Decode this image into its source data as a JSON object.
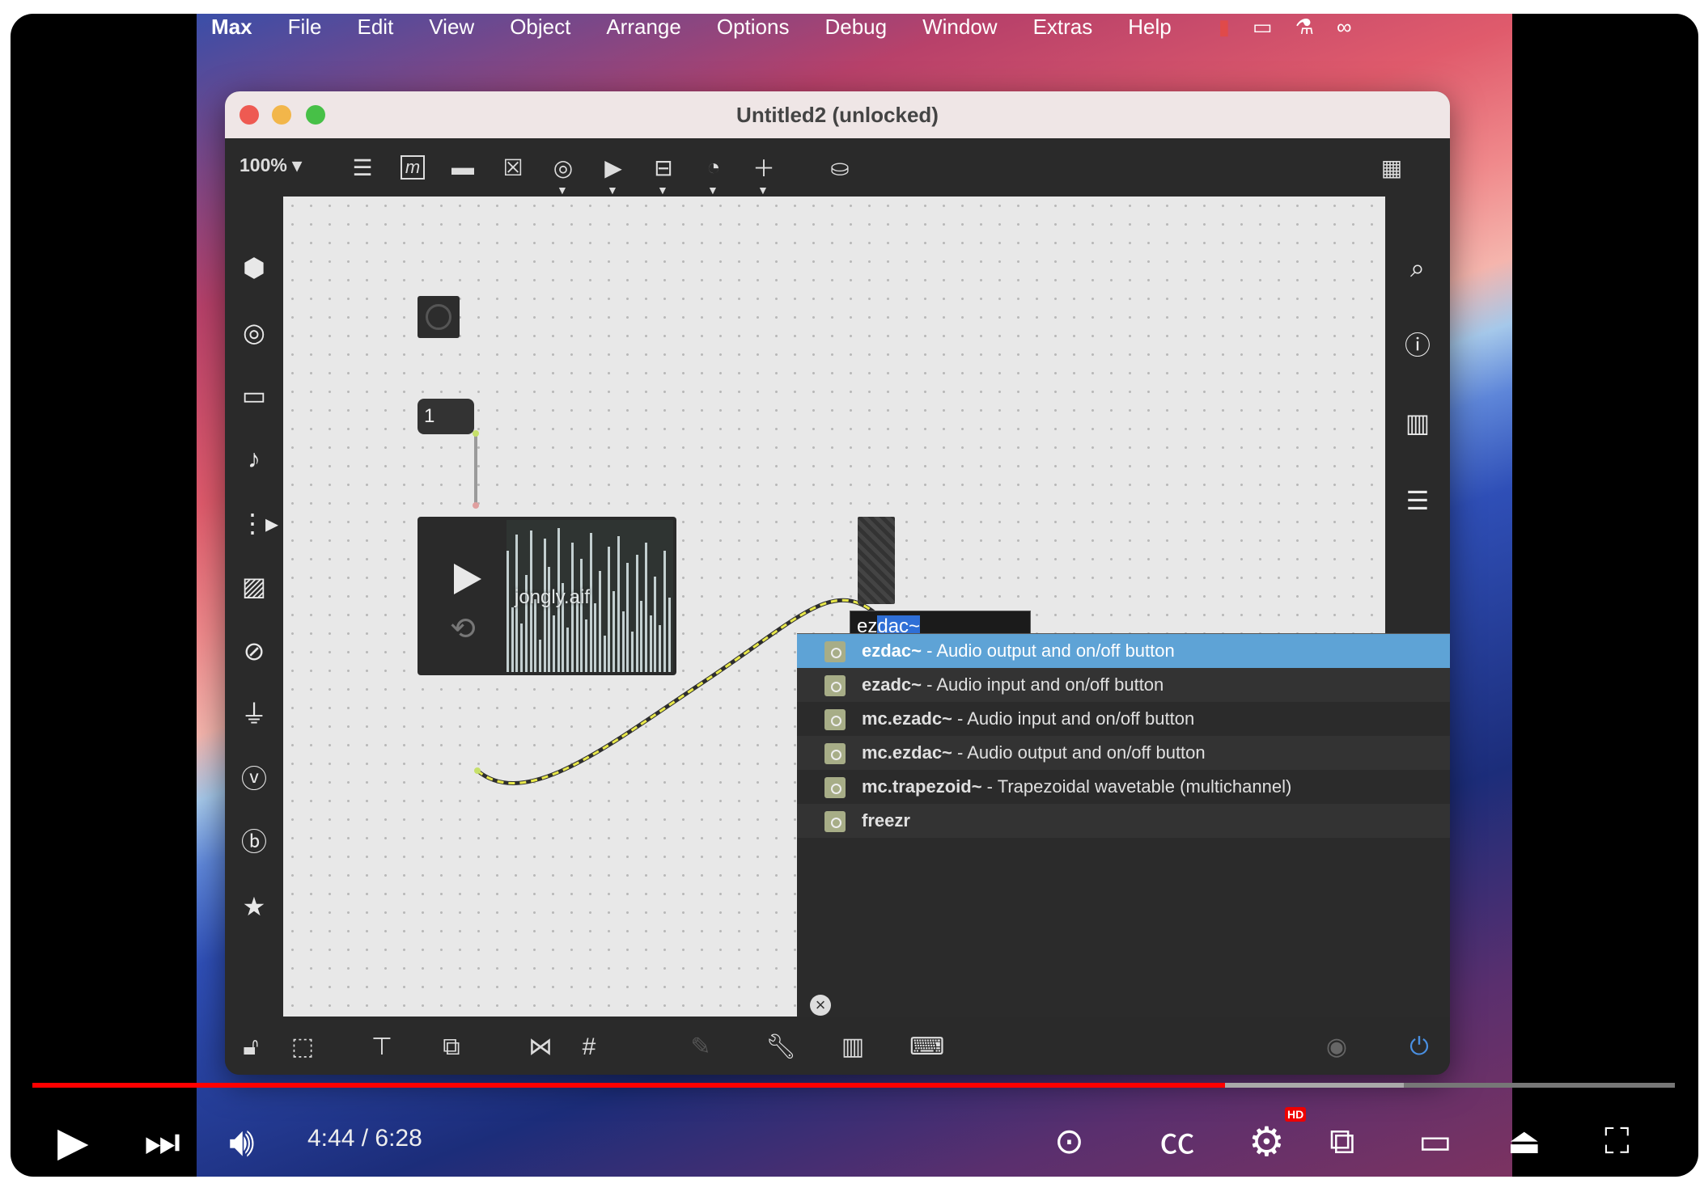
{
  "menubar": {
    "items": [
      "Max",
      "File",
      "Edit",
      "View",
      "Object",
      "Arrange",
      "Options",
      "Debug",
      "Window",
      "Extras",
      "Help"
    ]
  },
  "window": {
    "title": "Untitled2 (unlocked)",
    "zoom": "100% ▾"
  },
  "patcher": {
    "message_value": "1",
    "sound_file": "jongly.aif",
    "edit_text_plain": "ez",
    "edit_text_selected": "dac~"
  },
  "autocomplete": {
    "items": [
      {
        "name": "ezdac~",
        "desc": " - Audio output and on/off button",
        "selected": true
      },
      {
        "name": "ezadc~",
        "desc": " - Audio input and on/off button",
        "selected": false
      },
      {
        "name": "mc.ezadc~",
        "desc": " - Audio input and on/off button",
        "selected": false
      },
      {
        "name": "mc.ezdac~",
        "desc": " - Audio output and on/off button",
        "selected": false
      },
      {
        "name": "mc.trapezoid~",
        "desc": " - Trapezoidal wavetable (multichannel)",
        "selected": false
      },
      {
        "name": "freezr",
        "desc": "",
        "selected": false
      }
    ]
  },
  "video": {
    "time": "4:44 / 6:28",
    "progress_fraction": 0.726,
    "buffered_fraction": 0.835,
    "hd_badge": "HD"
  },
  "colors": {
    "accent_red": "#ff0000",
    "selection_blue": "#5ea3d6",
    "patch_cord_yellow": "#e8e84a"
  }
}
